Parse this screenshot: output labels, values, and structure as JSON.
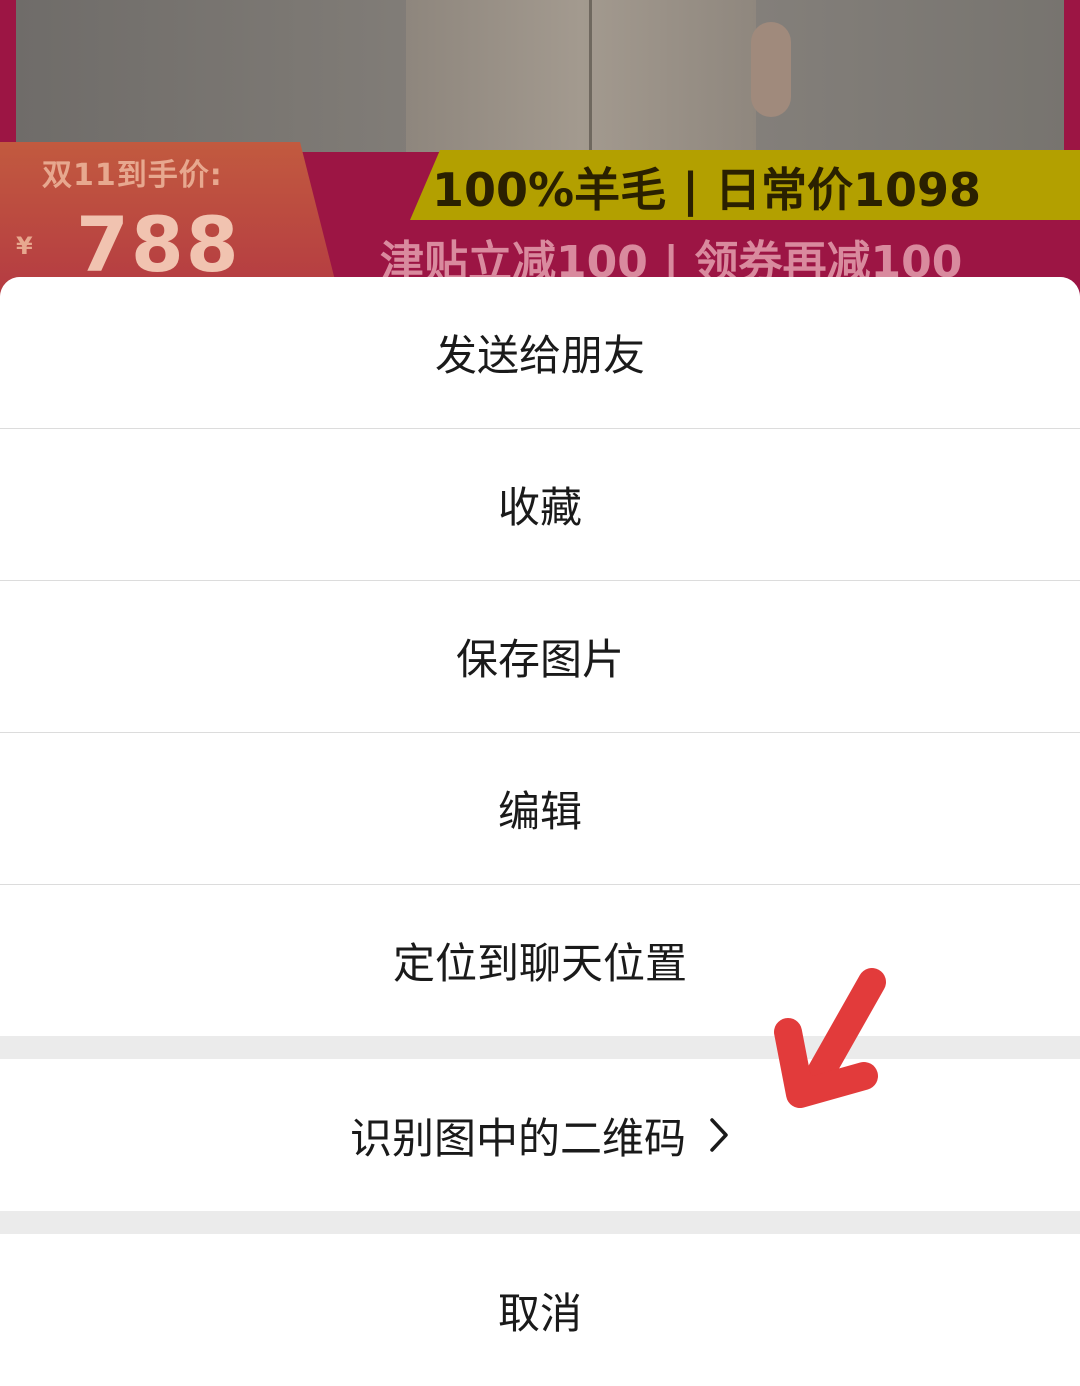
{
  "banner": {
    "price_label": "双11到手价:",
    "price_symbol": "¥",
    "price_value": "788",
    "highlight_text": "100%羊毛 | 日常价1098",
    "promo_text": "津贴立减100 | 领券再减100"
  },
  "action_sheet": {
    "items": [
      {
        "label": "发送给朋友"
      },
      {
        "label": "收藏"
      },
      {
        "label": "保存图片"
      },
      {
        "label": "编辑"
      },
      {
        "label": "定位到聊天位置"
      },
      {
        "label": "识别图中的二维码"
      }
    ],
    "cancel_label": "取消"
  },
  "colors": {
    "sheet_background": "#ffffff",
    "separator": "#ebebeb",
    "text": "#1a1a1a",
    "annotation_arrow": "#e23b3b"
  },
  "icons": {
    "qr_chevron": "chevron-right-icon",
    "annotation": "red-arrow-annotation-icon"
  }
}
